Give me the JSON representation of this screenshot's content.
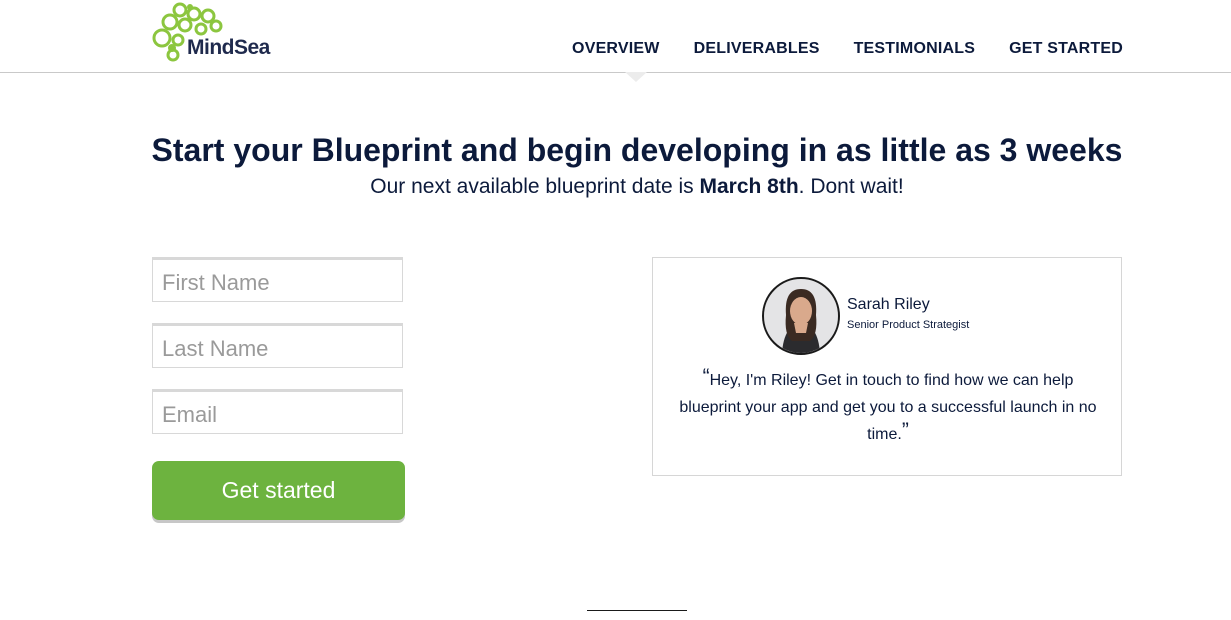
{
  "brand": {
    "name": "MindSea",
    "accent": "#6db33f",
    "logo_color": "#8cc63f"
  },
  "nav": {
    "items": [
      "OVERVIEW",
      "DELIVERABLES",
      "TESTIMONIALS",
      "GET STARTED"
    ]
  },
  "hero": {
    "headline": "Start your Blueprint and begin developing in as little as 3 weeks",
    "sub_prefix": "Our next available blueprint date is ",
    "sub_date": "March 8th",
    "sub_suffix": ". Dont wait!"
  },
  "form": {
    "first_name_placeholder": "First Name",
    "last_name_placeholder": "Last Name",
    "email_placeholder": "Email",
    "submit_label": "Get started"
  },
  "testimonial": {
    "name": "Sarah Riley",
    "title": "Senior Product Strategist",
    "open_quote": "“",
    "text": "Hey, I'm Riley! Get in touch to find how we can help blueprint your app and get you to a successful launch in no time.",
    "close_quote": "”"
  }
}
